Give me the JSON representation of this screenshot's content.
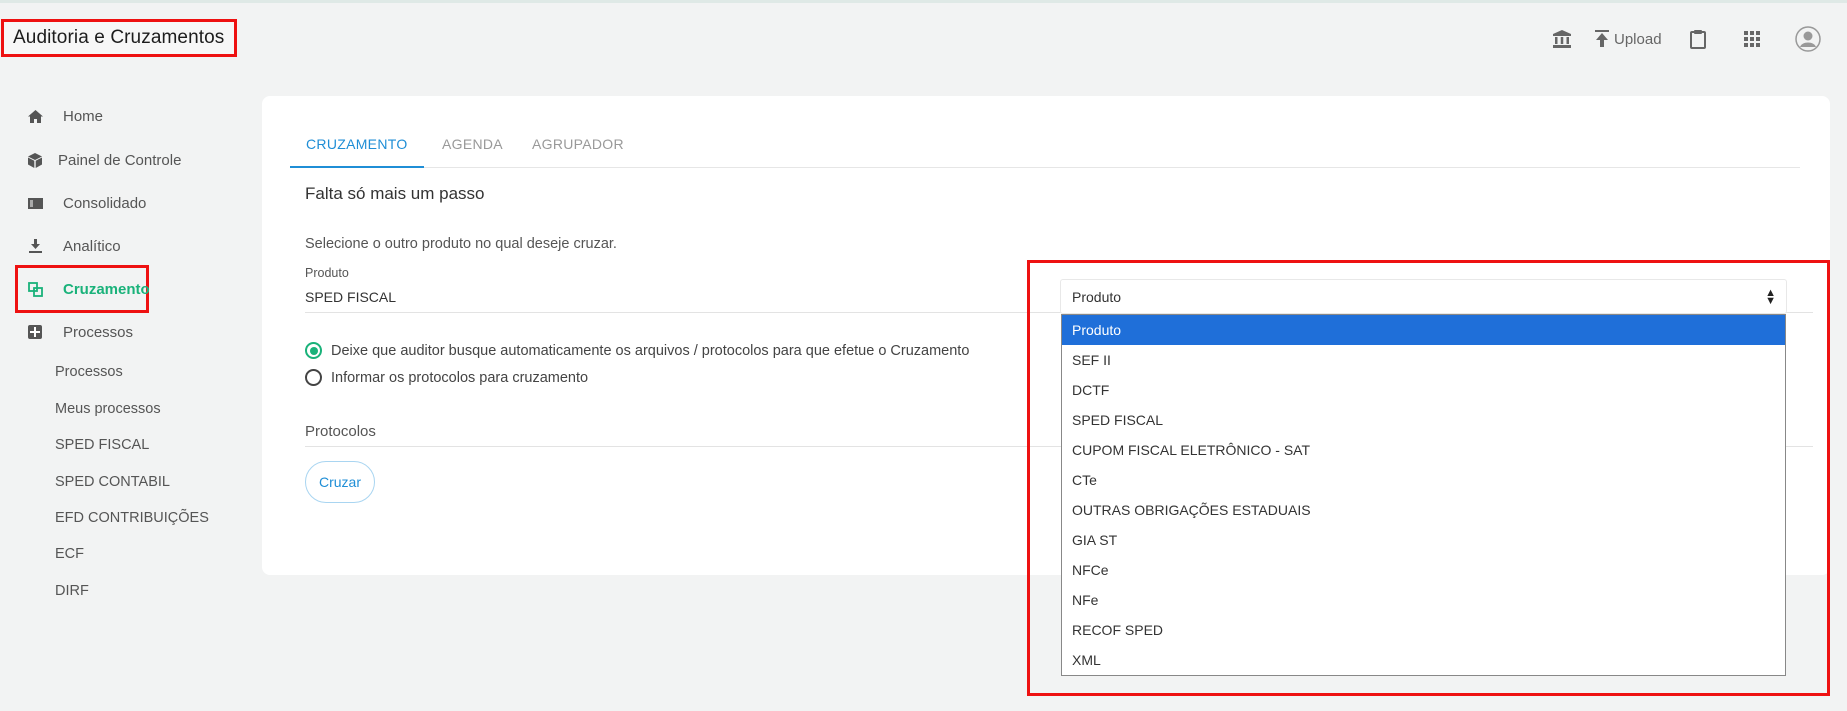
{
  "header": {
    "app_title": "Auditoria e Cruzamentos",
    "upload_label": "Upload",
    "icons": [
      "bank-icon",
      "upload-icon",
      "clipboard-icon",
      "apps-grid-icon",
      "user-avatar-icon"
    ]
  },
  "sidebar": {
    "items": [
      {
        "label": "Home",
        "icon": "home-icon"
      },
      {
        "label": "Painel de Controle",
        "icon": "box-icon"
      },
      {
        "label": "Consolidado",
        "icon": "card-icon"
      },
      {
        "label": "Analítico",
        "icon": "download-icon"
      },
      {
        "label": "Cruzamento",
        "icon": "cross-grid-icon",
        "active": true
      },
      {
        "label": "Processos",
        "icon": "puzzle-icon"
      }
    ],
    "sub_items": [
      "Processos",
      "Meus processos",
      "SPED FISCAL",
      "SPED CONTABIL",
      "EFD CONTRIBUIÇÕES",
      "ECF",
      "DIRF"
    ]
  },
  "main": {
    "tabs": [
      {
        "label": "CRUZAMENTO",
        "active": true
      },
      {
        "label": "AGENDA"
      },
      {
        "label": "AGRUPADOR"
      }
    ],
    "step_title": "Falta só mais um passo",
    "instruction": "Selecione o outro produto no qual deseje cruzar.",
    "field": {
      "label": "Produto",
      "value": "SPED FISCAL"
    },
    "radios": [
      {
        "label": "Deixe que auditor busque automaticamente os arquivos / protocolos para que efetue o Cruzamento",
        "checked": true
      },
      {
        "label": "Informar os protocolos para cruzamento",
        "checked": false
      }
    ],
    "protocols_label": "Protocolos",
    "submit_label": "Cruzar"
  },
  "product_select": {
    "selected": "Produto",
    "options": [
      "Produto",
      "SEF II",
      "DCTF",
      "SPED FISCAL",
      "CUPOM FISCAL ELETRÔNICO - SAT",
      "CTe",
      "OUTRAS OBRIGAÇÕES ESTADUAIS",
      "GIA ST",
      "NFCe",
      "NFe",
      "RECOF SPED",
      "XML"
    ],
    "highlighted_option": "Produto"
  },
  "colors": {
    "accent_green": "#1ab27a",
    "accent_blue": "#1f8ed6",
    "annotation_red": "#ee1111",
    "option_selected_bg": "#1f6fd9"
  }
}
